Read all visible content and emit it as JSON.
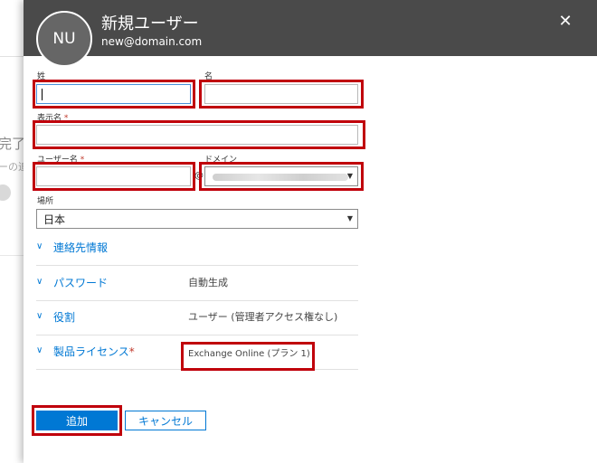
{
  "background": {
    "heading_fragment": "完了し",
    "sub_fragment": "ーの追"
  },
  "header": {
    "avatar_initials": "NU",
    "title": "新規ユーザー",
    "email": "new@domain.com",
    "close_glyph": "✕"
  },
  "form": {
    "last_name": {
      "label": "姓",
      "value": ""
    },
    "first_name": {
      "label": "名",
      "value": ""
    },
    "display_name": {
      "label": "表示名",
      "required_mark": "*",
      "value": ""
    },
    "username": {
      "label": "ユーザー名",
      "required_mark": "*",
      "value": ""
    },
    "at_sign": "@",
    "domain": {
      "label": "ドメイン"
    },
    "location": {
      "label": "場所",
      "selected": "日本"
    }
  },
  "sections": [
    {
      "label": "連絡先情報",
      "value": ""
    },
    {
      "label": "パスワード",
      "value": "自動生成"
    },
    {
      "label": "役割",
      "value": "ユーザー (管理者アクセス権なし)"
    },
    {
      "label": "製品ライセンス",
      "required_mark": "*",
      "value": "Exchange Online (プラン 1)"
    }
  ],
  "icons": {
    "chevron": "chevron-down-icon",
    "select_arrow": "caret-down-icon",
    "close": "close-icon"
  },
  "buttons": {
    "add": "追加",
    "cancel": "キャンセル"
  },
  "colors": {
    "header_bg": "#4a4a4a",
    "accent": "#0078d4",
    "highlight": "#c0000b"
  }
}
